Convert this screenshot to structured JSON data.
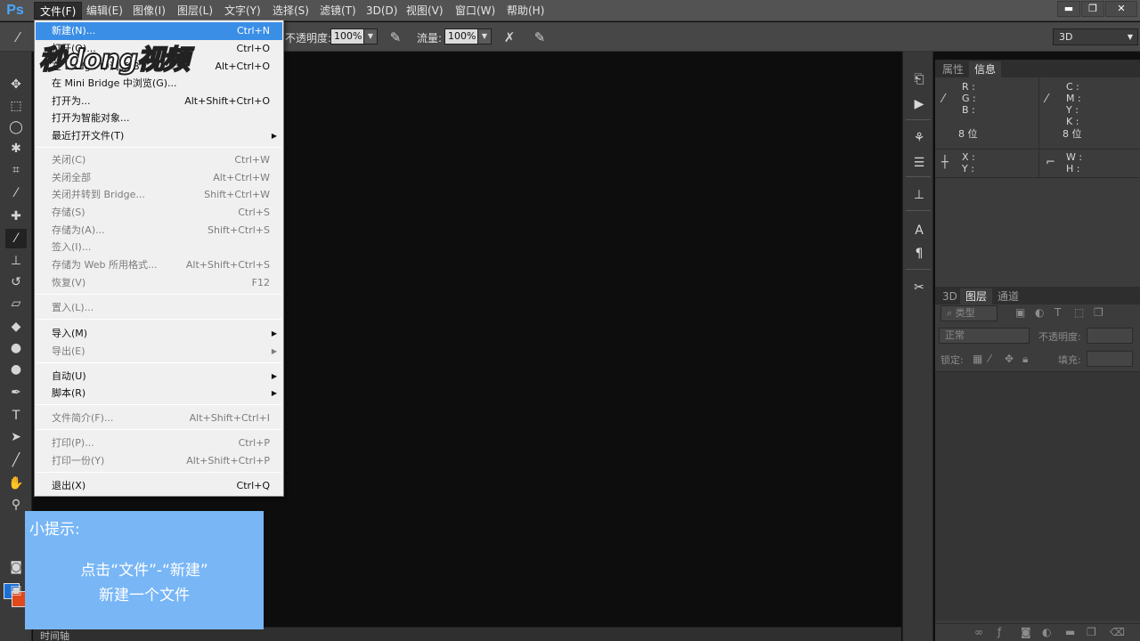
{
  "app": {
    "logo": "Ps"
  },
  "menubar": {
    "items": [
      {
        "label": "文件(F)"
      },
      {
        "label": "编辑(E)"
      },
      {
        "label": "图像(I)"
      },
      {
        "label": "图层(L)"
      },
      {
        "label": "文字(Y)"
      },
      {
        "label": "选择(S)"
      },
      {
        "label": "滤镜(T)"
      },
      {
        "label": "3D(D)"
      },
      {
        "label": "视图(V)"
      },
      {
        "label": "窗口(W)"
      },
      {
        "label": "帮助(H)"
      }
    ],
    "window_buttons": [
      "▬",
      "❐",
      "✕"
    ]
  },
  "options": {
    "opacity_label": "不透明度:",
    "opacity_value": "100%",
    "flow_label": "流量:",
    "flow_value": "100%",
    "workspace": "3D"
  },
  "file_menu": {
    "items": [
      {
        "label": "新建(N)...",
        "shortcut": "Ctrl+N"
      },
      {
        "label": "打开(O)...",
        "shortcut": "Ctrl+O"
      },
      {
        "label": "在 Bridge 中浏览(B)...",
        "shortcut": "Alt+Ctrl+O"
      },
      {
        "label": "在 Mini Bridge 中浏览(G)...",
        "shortcut": ""
      },
      {
        "label": "打开为...",
        "shortcut": "Alt+Shift+Ctrl+O"
      },
      {
        "label": "打开为智能对象...",
        "shortcut": ""
      },
      {
        "label": "最近打开文件(T)",
        "shortcut": ""
      },
      {
        "label": "关闭(C)",
        "shortcut": "Ctrl+W"
      },
      {
        "label": "关闭全部",
        "shortcut": "Alt+Ctrl+W"
      },
      {
        "label": "关闭并转到 Bridge...",
        "shortcut": "Shift+Ctrl+W"
      },
      {
        "label": "存储(S)",
        "shortcut": "Ctrl+S"
      },
      {
        "label": "存储为(A)...",
        "shortcut": "Shift+Ctrl+S"
      },
      {
        "label": "签入(I)...",
        "shortcut": ""
      },
      {
        "label": "存储为 Web 所用格式...",
        "shortcut": "Alt+Shift+Ctrl+S"
      },
      {
        "label": "恢复(V)",
        "shortcut": "F12"
      },
      {
        "label": "置入(L)...",
        "shortcut": ""
      },
      {
        "label": "导入(M)",
        "shortcut": ""
      },
      {
        "label": "导出(E)",
        "shortcut": ""
      },
      {
        "label": "自动(U)",
        "shortcut": ""
      },
      {
        "label": "脚本(R)",
        "shortcut": ""
      },
      {
        "label": "文件简介(F)...",
        "shortcut": "Alt+Shift+Ctrl+I"
      },
      {
        "label": "打印(P)...",
        "shortcut": "Ctrl+P"
      },
      {
        "label": "打印一份(Y)",
        "shortcut": "Alt+Shift+Ctrl+P"
      },
      {
        "label": "退出(X)",
        "shortcut": "Ctrl+Q"
      }
    ]
  },
  "watermark": {
    "text": "秒dong视频"
  },
  "info_panel": {
    "tabs": [
      "属性",
      "信息"
    ],
    "rgb": "R :\nG :\nB :",
    "cmyk": "C :\nM :\nY :\nK :",
    "bits_left": "8 位",
    "bits_right": "8 位",
    "xy": "X :\nY :",
    "wh": "W :\nH :"
  },
  "layers_panel": {
    "tabs": [
      "3D",
      "图层",
      "通道"
    ],
    "filter_label": "类型",
    "blend_mode": "正常",
    "opacity_label": "不透明度:",
    "lock_label": "锁定:",
    "fill_label": "填充:"
  },
  "timeline": {
    "label": "时间轴"
  },
  "tip": {
    "title": "小提示:",
    "line1": "点击“文件”-“新建”",
    "line2": "新建一个文件"
  },
  "colors": {
    "foreground": "#1a6fd6",
    "background": "#e0491b",
    "menu_highlight": "#3a8ee6",
    "tip_box": "#78b6f5"
  }
}
